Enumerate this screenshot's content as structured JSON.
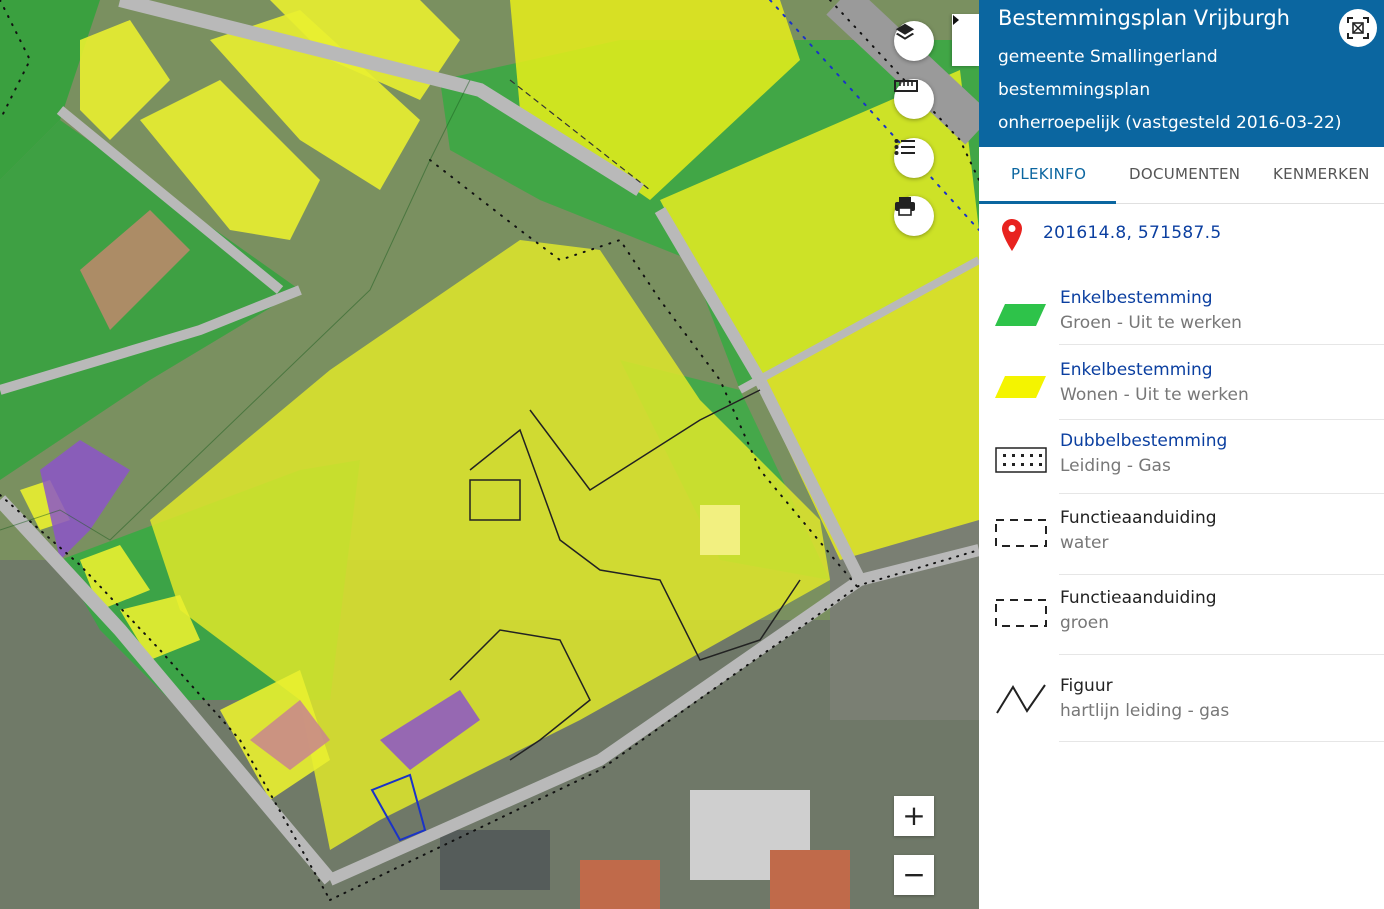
{
  "panel": {
    "title": "Bestemmingsplan Vrijburgh",
    "municipality": "gemeente Smallingerland",
    "plan_type": "bestemmingsplan",
    "status": "onherroepelijk (vastgesteld 2016-03-22)"
  },
  "tabs": [
    {
      "label": "PLEKINFO",
      "active": true
    },
    {
      "label": "DOCUMENTEN",
      "active": false
    },
    {
      "label": "KENMERKEN",
      "active": false
    }
  ],
  "location": {
    "coordinates": "201614.8, 571587.5"
  },
  "legend": [
    {
      "category": "Enkelbestemming",
      "name": "Groen - Uit te werken",
      "symbol": "green-parallelogram-icon",
      "color": "#2ec34a",
      "link": true
    },
    {
      "category": "Enkelbestemming",
      "name": "Wonen - Uit te werken",
      "symbol": "yellow-parallelogram-icon",
      "color": "#f4f400",
      "link": true
    },
    {
      "category": "Dubbelbestemming",
      "name": "Leiding - Gas",
      "symbol": "dotted-rectangle-icon",
      "color": "#222222",
      "link": true
    },
    {
      "category": "Functieaanduiding",
      "name": "water",
      "symbol": "dashed-rectangle-icon",
      "color": "#222222",
      "link": false
    },
    {
      "category": "Functieaanduiding",
      "name": "groen",
      "symbol": "dashed-rectangle-icon",
      "color": "#222222",
      "link": false
    },
    {
      "category": "Figuur",
      "name": "hartlijn leiding - gas",
      "symbol": "zigzag-line-icon",
      "color": "#222222",
      "link": false
    }
  ],
  "map_controls": {
    "layers": "layers-icon",
    "measure": "ruler-icon",
    "legend": "list-icon",
    "print": "printer-icon",
    "zoom_in": "+",
    "zoom_out": "−"
  },
  "colors": {
    "header": "#0b66a0",
    "link": "#0b3fa0",
    "green_zone": "#2ec34a",
    "yellow_zone": "#f4f400",
    "purple_zone": "#9b5fd0"
  }
}
